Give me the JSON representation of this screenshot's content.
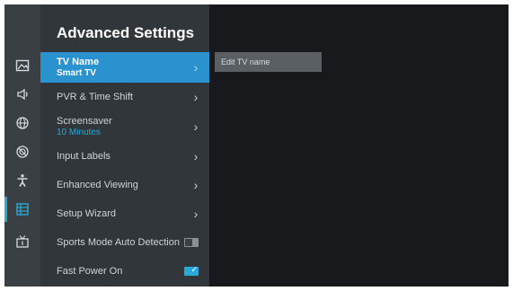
{
  "panel": {
    "title": "Advanced Settings",
    "items": [
      {
        "label": "TV Name",
        "sub": "Smart TV",
        "type": "submenu",
        "selected": true
      },
      {
        "label": "PVR & Time Shift",
        "sub": "",
        "type": "submenu",
        "selected": false
      },
      {
        "label": "Screensaver",
        "sub": "10 Minutes",
        "type": "submenu",
        "selected": false
      },
      {
        "label": "Input Labels",
        "sub": "",
        "type": "submenu",
        "selected": false
      },
      {
        "label": "Enhanced Viewing",
        "sub": "",
        "type": "submenu",
        "selected": false
      },
      {
        "label": "Setup Wizard",
        "sub": "",
        "type": "submenu",
        "selected": false
      },
      {
        "label": "Sports Mode Auto Detection",
        "sub": "",
        "type": "toggle",
        "value": false
      },
      {
        "label": "Fast Power On",
        "sub": "",
        "type": "toggle",
        "value": true
      }
    ]
  },
  "detail": {
    "option_label": "Edit TV name"
  },
  "rail": {
    "icons": [
      "picture-icon",
      "sound-icon",
      "network-icon",
      "channel-icon",
      "accessibility-icon",
      "system-icon",
      "support-icon"
    ],
    "active": "system-icon"
  },
  "colors": {
    "accent": "#2aa9d8",
    "selected": "#2a92cf",
    "panel": "#31363b",
    "rail": "#3a3f44",
    "background": "#17191c"
  }
}
